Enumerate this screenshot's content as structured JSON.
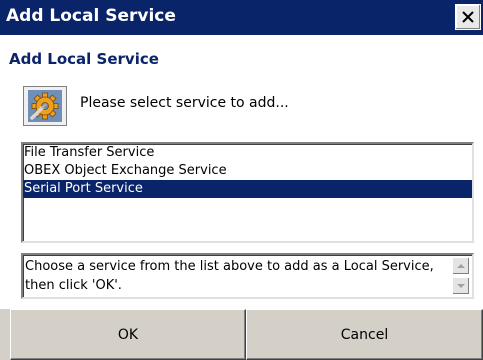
{
  "window": {
    "title": "Add Local Service"
  },
  "dialog": {
    "heading": "Add Local Service",
    "prompt": "Please select service to add...",
    "icon": "gear-wrench-icon"
  },
  "services": {
    "items": [
      {
        "label": "File Transfer Service",
        "selected": false
      },
      {
        "label": "OBEX Object Exchange Service",
        "selected": false
      },
      {
        "label": "Serial Port Service",
        "selected": true
      }
    ]
  },
  "description": {
    "text": "Choose a service from the list above to add as a Local Service, then click 'OK'."
  },
  "buttons": {
    "ok": "OK",
    "cancel": "Cancel"
  },
  "colors": {
    "titlebar": "#0a246a",
    "selection": "#0a246a",
    "heading": "#0a246a",
    "button_face": "#d4d0c8"
  }
}
